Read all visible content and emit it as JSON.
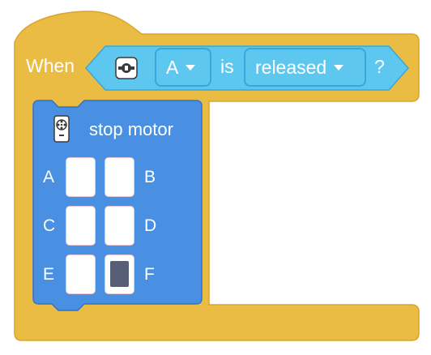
{
  "hat_block": {
    "when_label": "When",
    "color": "#ebbc44",
    "condition": {
      "color": "#5ec7ef",
      "icon": "remote-control-icon",
      "button_value": "A",
      "is_label": "is",
      "state_value": "released",
      "question": "?"
    }
  },
  "command_block": {
    "color": "#4a90e2",
    "icon": "motor-icon",
    "label": "stop motor",
    "ports": [
      {
        "left": "A",
        "right": "B",
        "left_selected": false,
        "right_selected": false
      },
      {
        "left": "C",
        "right": "D",
        "left_selected": false,
        "right_selected": false
      },
      {
        "left": "E",
        "right": "F",
        "left_selected": false,
        "right_selected": true
      }
    ]
  }
}
